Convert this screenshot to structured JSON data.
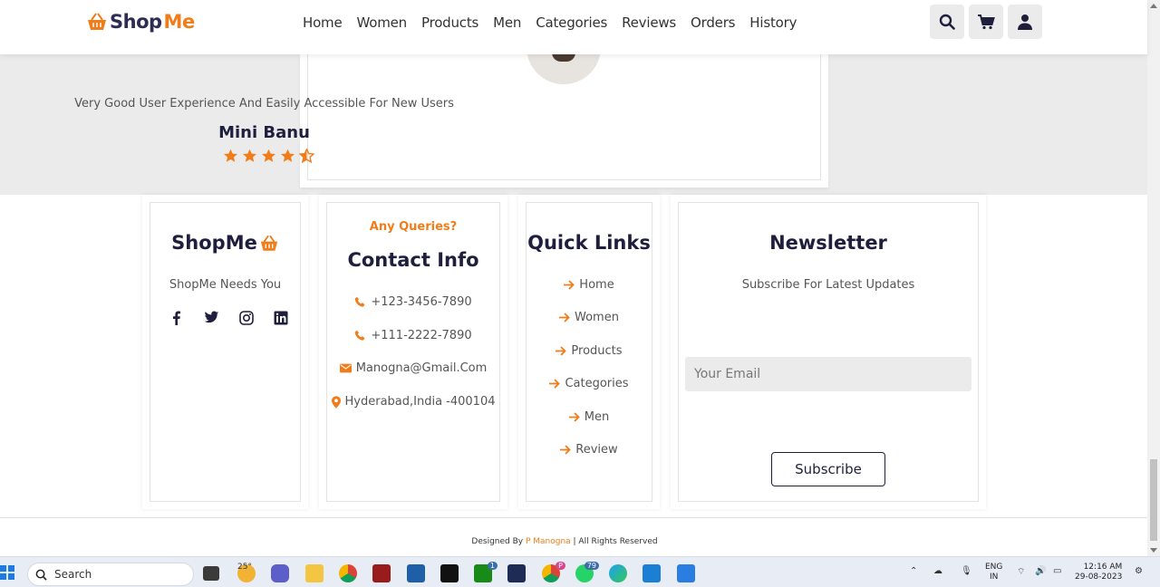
{
  "header": {
    "logo_shop": "Shop",
    "logo_me": "Me",
    "nav": [
      "Home",
      "Women",
      "Products",
      "Men",
      "Categories",
      "Reviews",
      "Orders",
      "History"
    ],
    "icons": [
      "search-icon",
      "cart-icon",
      "user-icon"
    ]
  },
  "review": {
    "text": "Very Good User Experience And Easily Accessible For New Users",
    "name": "Mini Banu",
    "rating": 4.5
  },
  "footer": {
    "brand": {
      "title": "ShopMe",
      "tagline": "ShopMe Needs You",
      "social": [
        "facebook-icon",
        "twitter-icon",
        "instagram-icon",
        "linkedin-icon"
      ]
    },
    "contact": {
      "kicker": "Any Queries?",
      "title": "Contact Info",
      "items": [
        "+123-3456-7890",
        "+111-2222-7890",
        "Manogna@Gmail.Com",
        "Hyderabad,India -400104"
      ]
    },
    "quick_links": {
      "title": "Quick Links",
      "items": [
        "Home",
        "Women",
        "Products",
        "Categories",
        "Men",
        "Review"
      ]
    },
    "newsletter": {
      "title": "Newsletter",
      "text": "Subscribe For Latest Updates",
      "email_placeholder": "Your Email",
      "button": "Subscribe"
    },
    "credit_prefix": "Designed By ",
    "credit_name": "P Manogna",
    "credit_suffix": " | All Rights Reserved"
  },
  "taskbar": {
    "search_label": "Search",
    "weather": "25°",
    "badges": {
      "xbox": "1",
      "chrome_profile": "P",
      "whatsapp": "79"
    },
    "lang_1": "ENG",
    "lang_2": "IN",
    "time": "12:16 AM",
    "date": "29-08-2023"
  },
  "colors": {
    "accent": "#f07d1a",
    "navy": "#1f1f3d"
  }
}
